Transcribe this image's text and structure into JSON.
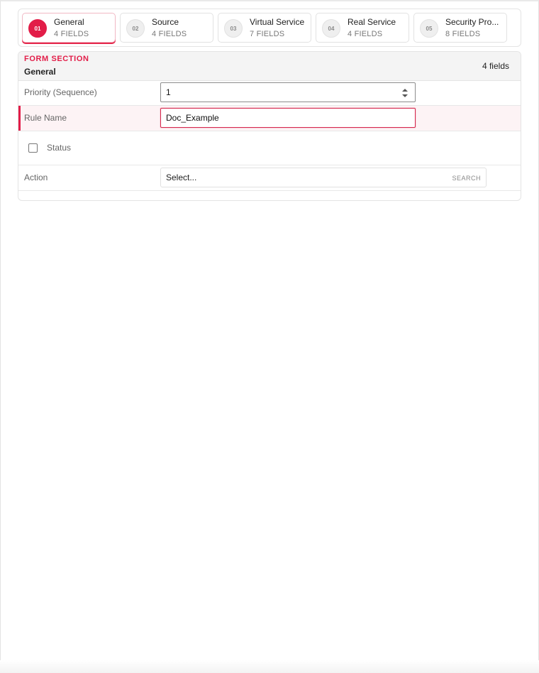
{
  "steps": [
    {
      "num": "01",
      "title": "General",
      "sub": "4 FIELDS",
      "active": true
    },
    {
      "num": "02",
      "title": "Source",
      "sub": "4 FIELDS",
      "active": false
    },
    {
      "num": "03",
      "title": "Virtual Service",
      "sub": "7 FIELDS",
      "active": false
    },
    {
      "num": "04",
      "title": "Real Service",
      "sub": "4 FIELDS",
      "active": false
    },
    {
      "num": "05",
      "title": "Security Pro...",
      "sub": "8 FIELDS",
      "active": false
    }
  ],
  "section": {
    "kicker": "FORM SECTION",
    "title": "General",
    "count": "4 fields"
  },
  "fields": {
    "priority": {
      "label": "Priority (Sequence)",
      "value": "1"
    },
    "rule_name": {
      "label": "Rule Name",
      "value": "Doc_Example"
    },
    "status": {
      "label": "Status",
      "checked": false
    },
    "action": {
      "label": "Action",
      "value": "Select...",
      "hint": "SEARCH"
    }
  },
  "colors": {
    "accent": "#e21d48"
  }
}
